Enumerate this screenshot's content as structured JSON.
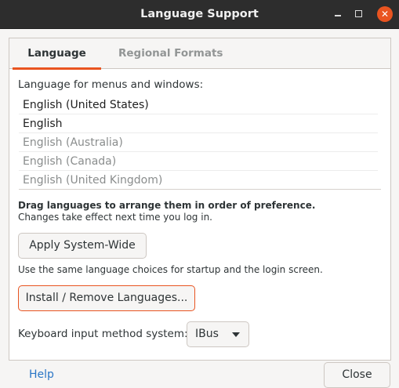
{
  "window": {
    "title": "Language Support",
    "minimize_label": "minimize",
    "maximize_label": "maximize",
    "close_glyph": "✕"
  },
  "tabs": [
    {
      "label": "Language",
      "active": true
    },
    {
      "label": "Regional Formats",
      "active": false
    }
  ],
  "language_tab": {
    "list_heading": "Language for menus and windows:",
    "languages": [
      {
        "label": "English (United States)",
        "enabled": true
      },
      {
        "label": "English",
        "enabled": true
      },
      {
        "label": "English (Australia)",
        "enabled": false
      },
      {
        "label": "English (Canada)",
        "enabled": false
      },
      {
        "label": "English (United Kingdom)",
        "enabled": false
      }
    ],
    "drag_hint": "Drag languages to arrange them in order of preference.",
    "changes_hint": "Changes take effect next time you log in.",
    "apply_button": "Apply System-Wide",
    "apply_hint": "Use the same language choices for startup and the login screen.",
    "install_button": "Install / Remove Languages...",
    "keyboard_label": "Keyboard input method system:",
    "keyboard_value": "IBus"
  },
  "footer": {
    "help_label": "Help",
    "close_button": "Close"
  },
  "colors": {
    "accent": "#e95420",
    "titlebar": "#2d2d2d",
    "link": "#2a76c6"
  }
}
